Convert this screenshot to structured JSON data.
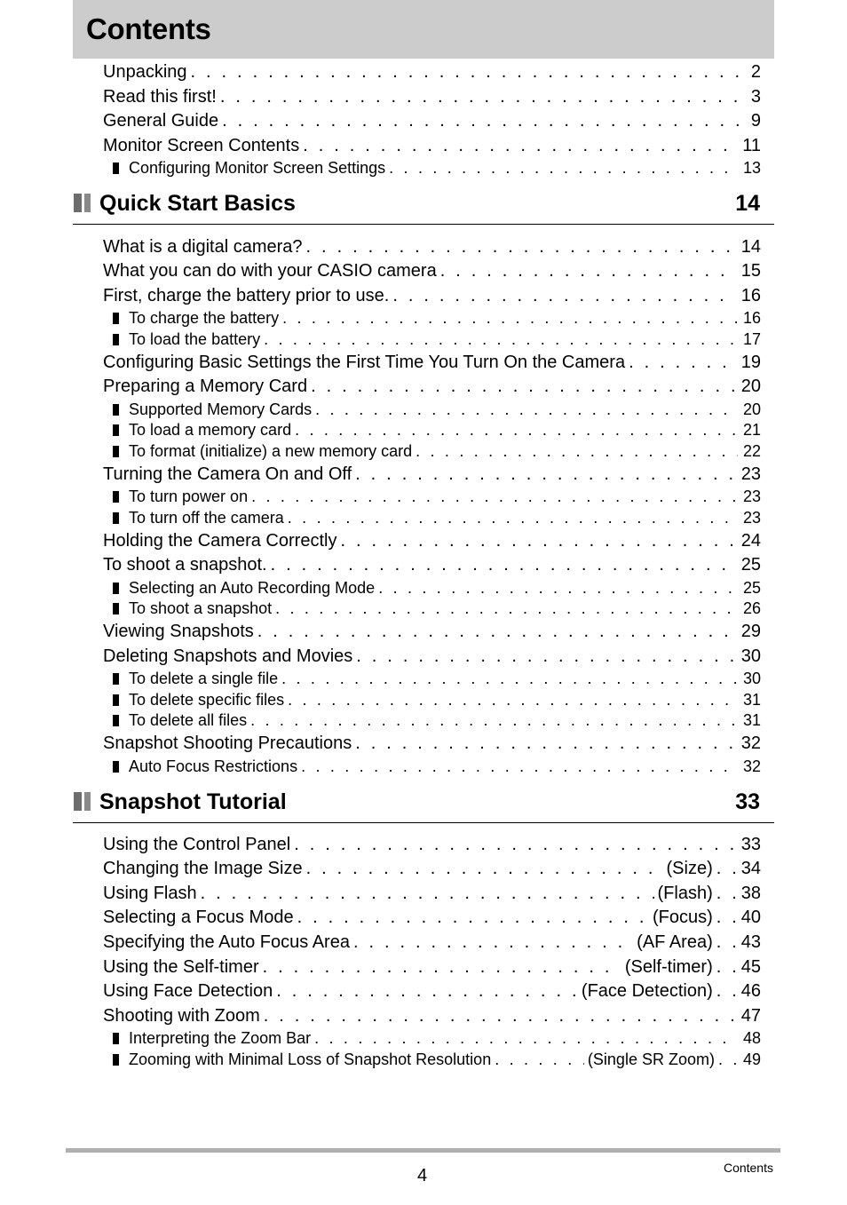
{
  "document": {
    "title": "Contents",
    "intro_entries": [
      {
        "label": "Unpacking",
        "page": "2",
        "level": 1
      },
      {
        "label": "Read this first!",
        "page": "3",
        "level": 1
      },
      {
        "label": "General Guide",
        "page": "9",
        "level": 1
      },
      {
        "label": "Monitor Screen Contents",
        "page": "11",
        "level": 1
      },
      {
        "label": "Configuring Monitor Screen Settings",
        "page": "13",
        "level": 2
      }
    ],
    "sections": [
      {
        "title": "Quick Start Basics",
        "page": "14",
        "entries": [
          {
            "label": "What is a digital camera?",
            "page": "14",
            "level": 1
          },
          {
            "label": "What you can do with your CASIO camera",
            "page": "15",
            "level": 1
          },
          {
            "label": "First, charge the battery prior to use.",
            "page": "16",
            "level": 1
          },
          {
            "label": "To charge the battery",
            "page": "16",
            "level": 2
          },
          {
            "label": "To load the battery",
            "page": "17",
            "level": 2
          },
          {
            "label": "Configuring Basic Settings the First Time You Turn On the Camera",
            "page": "19",
            "level": 1
          },
          {
            "label": "Preparing a Memory Card",
            "page": "20",
            "level": 1
          },
          {
            "label": "Supported Memory Cards",
            "page": "20",
            "level": 2
          },
          {
            "label": "To load a memory card",
            "page": "21",
            "level": 2
          },
          {
            "label": "To format (initialize) a new memory card",
            "page": "22",
            "level": 2
          },
          {
            "label": "Turning the Camera On and Off",
            "page": "23",
            "level": 1
          },
          {
            "label": "To turn power on",
            "page": "23",
            "level": 2
          },
          {
            "label": "To turn off the camera",
            "page": "23",
            "level": 2
          },
          {
            "label": "Holding the Camera Correctly",
            "page": "24",
            "level": 1
          },
          {
            "label": "To shoot a snapshot.",
            "page": "25",
            "level": 1
          },
          {
            "label": "Selecting an Auto Recording Mode",
            "page": "25",
            "level": 2
          },
          {
            "label": "To shoot a snapshot",
            "page": "26",
            "level": 2
          },
          {
            "label": "Viewing Snapshots",
            "page": "29",
            "level": 1
          },
          {
            "label": "Deleting Snapshots and Movies",
            "page": "30",
            "level": 1
          },
          {
            "label": "To delete a single file",
            "page": "30",
            "level": 2
          },
          {
            "label": "To delete specific files",
            "page": "31",
            "level": 2
          },
          {
            "label": "To delete all files",
            "page": "31",
            "level": 2
          },
          {
            "label": "Snapshot Shooting Precautions",
            "page": "32",
            "level": 1
          },
          {
            "label": "Auto Focus Restrictions",
            "page": "32",
            "level": 2
          }
        ]
      },
      {
        "title": "Snapshot Tutorial",
        "page": "33",
        "entries": [
          {
            "label": "Using the Control Panel",
            "page": "33",
            "level": 1
          },
          {
            "label": "Changing the Image Size",
            "tag": "(Size)",
            "page": "34",
            "level": 1
          },
          {
            "label": "Using Flash",
            "tag": "(Flash)",
            "page": "38",
            "level": 1
          },
          {
            "label": "Selecting a Focus Mode",
            "tag": "(Focus)",
            "page": "40",
            "level": 1
          },
          {
            "label": "Specifying the Auto Focus Area",
            "tag": "(AF Area)",
            "page": "43",
            "level": 1
          },
          {
            "label": "Using the Self-timer",
            "tag": "(Self-timer)",
            "page": "45",
            "level": 1
          },
          {
            "label": "Using Face Detection",
            "tag": "(Face Detection)",
            "page": "46",
            "level": 1
          },
          {
            "label": "Shooting with Zoom",
            "page": "47",
            "level": 1
          },
          {
            "label": "Interpreting the Zoom Bar",
            "page": "48",
            "level": 2
          },
          {
            "label": "Zooming with Minimal Loss of Snapshot Resolution",
            "tag": "(Single SR Zoom)",
            "page": "49",
            "level": 2
          }
        ]
      }
    ],
    "footer": {
      "page_number": "4",
      "label": "Contents"
    }
  }
}
